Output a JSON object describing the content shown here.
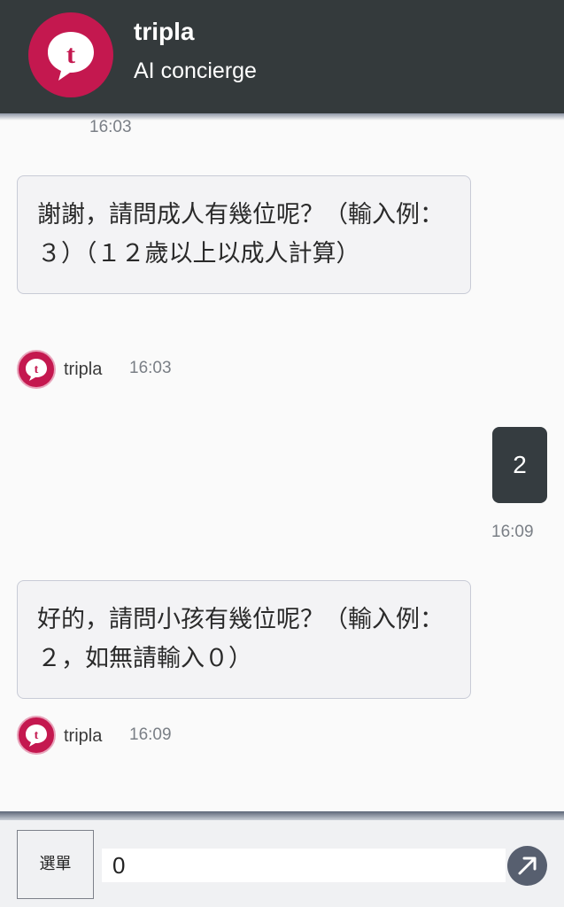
{
  "header": {
    "title": "tripla",
    "subtitle": "AI concierge",
    "logo_letter": "t"
  },
  "messages": {
    "top_time": "16:03",
    "bot1": {
      "text": "謝謝，請問成人有幾位呢？（輸入例：３）（１２歲以上以成人計算）",
      "name": "tripla",
      "time": "16:03"
    },
    "user1": {
      "text": "2",
      "time": "16:09"
    },
    "bot2": {
      "text": "好的，請問小孩有幾位呢？（輸入例：２，如無請輸入０）",
      "name": "tripla",
      "time": "16:09"
    }
  },
  "footer": {
    "menu_label": "選單",
    "input_value": "0"
  },
  "colors": {
    "header_bg": "#343a3c",
    "brand": "#c4184f",
    "user_bubble": "#353c40",
    "send_button": "#575f6f"
  },
  "icons": {
    "logo": "tripla-speech-bubble-icon",
    "send": "arrow-up-right-icon"
  }
}
